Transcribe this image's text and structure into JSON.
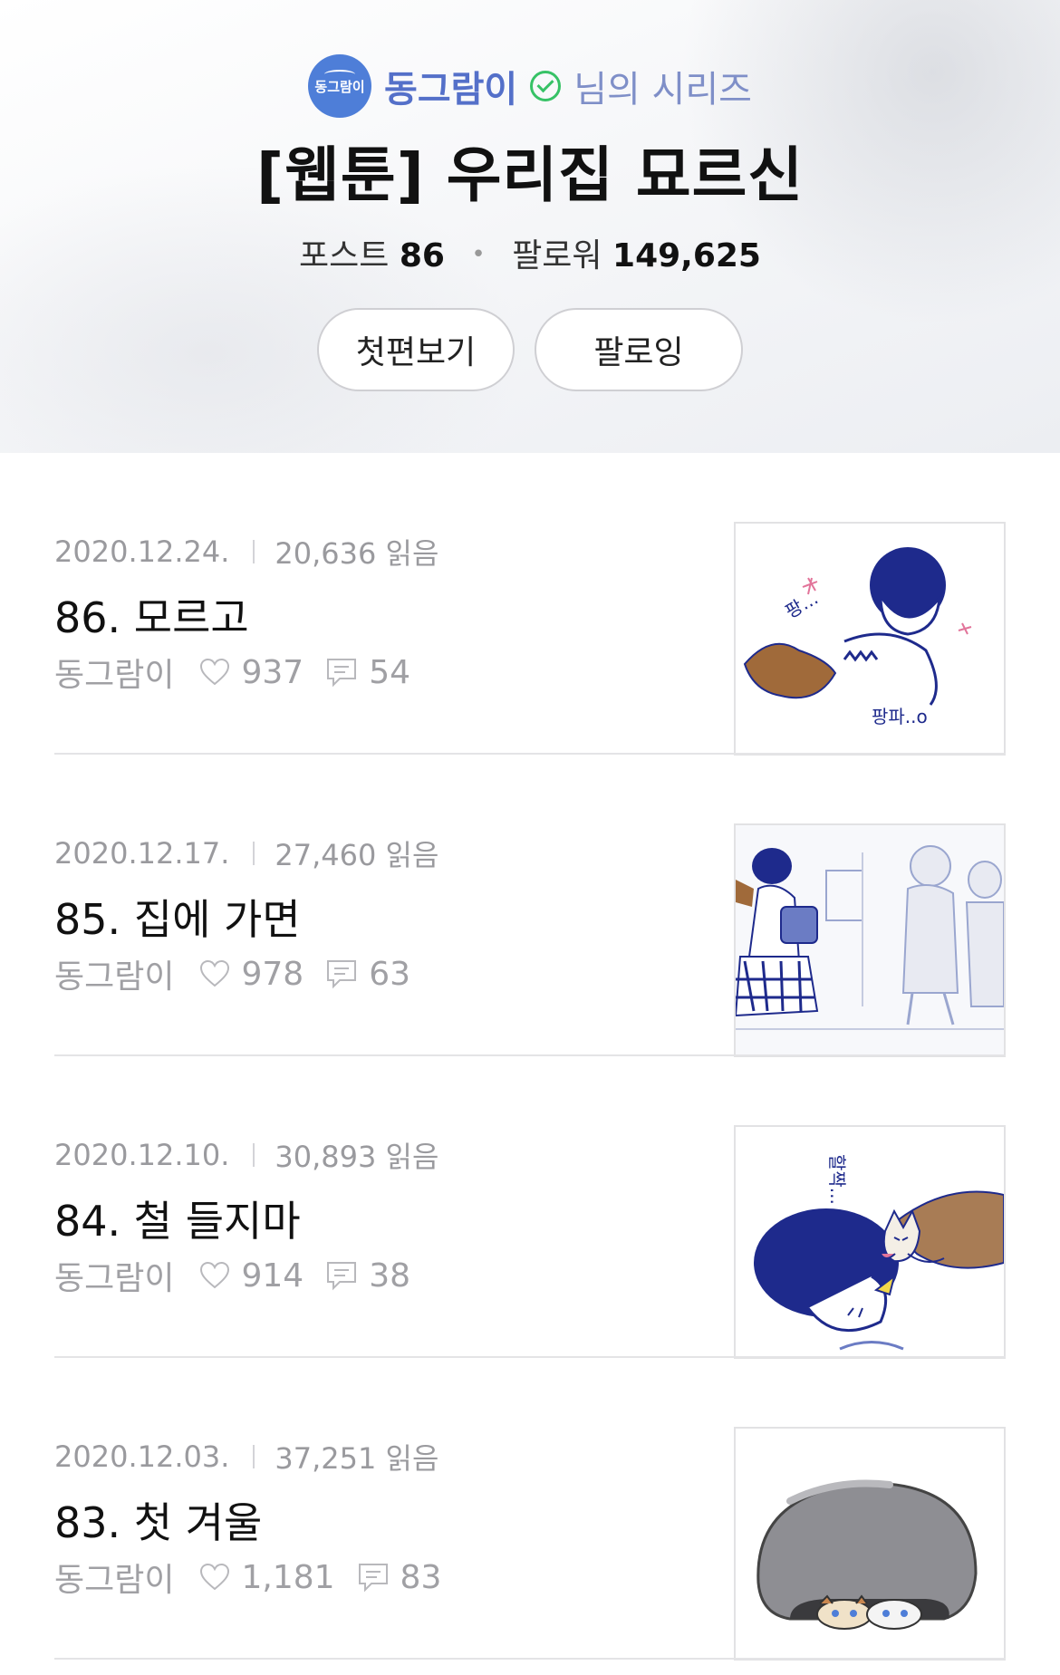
{
  "header": {
    "avatar_text": "동그람이",
    "author": "동그람이",
    "series_suffix": "님의 시리즈",
    "title": "[웹툰] 우리집 묘르신",
    "posts_label": "포스트",
    "posts_count": "86",
    "followers_label": "팔로워",
    "followers_count": "149,625",
    "first_episode_button": "첫편보기",
    "follow_button": "팔로잉"
  },
  "posts": [
    {
      "date": "2020.12.24.",
      "reads": "20,636 읽음",
      "title": "86. 모르고",
      "author": "동그람이",
      "likes": "937",
      "comments": "54",
      "thumb_text_1": "팡...",
      "thumb_text_2": "팡파..o"
    },
    {
      "date": "2020.12.17.",
      "reads": "27,460 읽음",
      "title": "85. 집에 가면",
      "author": "동그람이",
      "likes": "978",
      "comments": "63"
    },
    {
      "date": "2020.12.10.",
      "reads": "30,893 읽음",
      "title": "84. 철 들지마",
      "author": "동그람이",
      "likes": "914",
      "comments": "38",
      "thumb_text_1": "할짝..."
    },
    {
      "date": "2020.12.03.",
      "reads": "37,251 읽음",
      "title": "83. 첫 겨울",
      "author": "동그람이",
      "likes": "1,181",
      "comments": "83"
    }
  ],
  "colors": {
    "author_blue": "#5470c9",
    "verified_green": "#37c266",
    "meta_gray": "#9a9a9e",
    "ink_navy": "#1e2a8c"
  }
}
